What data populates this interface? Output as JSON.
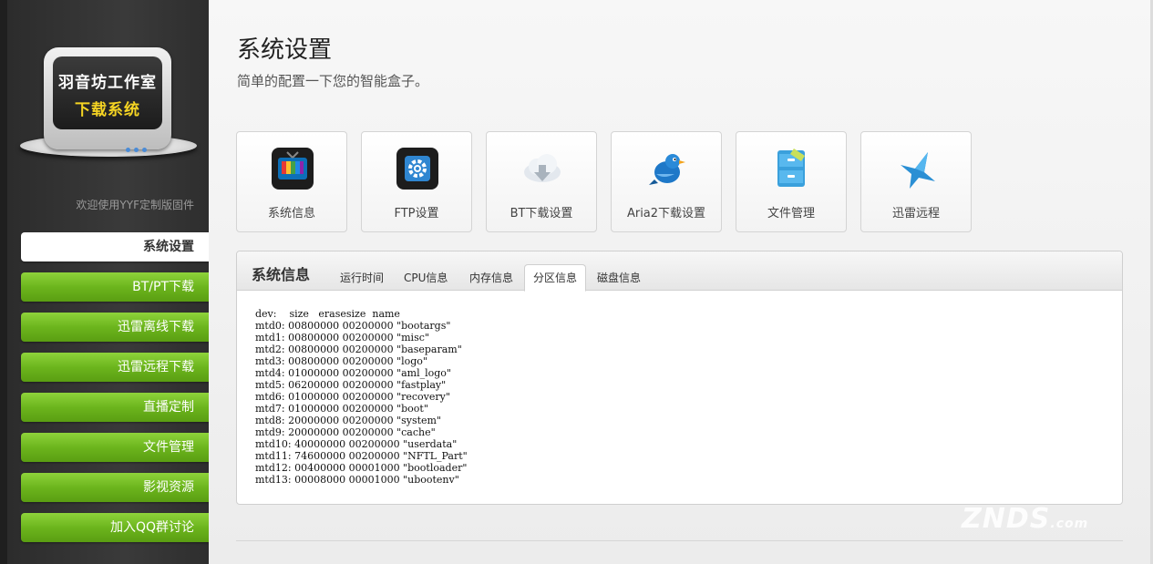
{
  "sidebar": {
    "logo": {
      "line1": "羽音坊工作室",
      "line2": "下载系统"
    },
    "welcome": "欢迎使用YYF定制版固件",
    "items": [
      {
        "label": "系统设置",
        "active": true
      },
      {
        "label": "BT/PT下载"
      },
      {
        "label": "迅雷离线下载"
      },
      {
        "label": "迅雷远程下载"
      },
      {
        "label": "直播定制"
      },
      {
        "label": "文件管理"
      },
      {
        "label": "影视资源"
      },
      {
        "label": "加入QQ群讨论"
      }
    ]
  },
  "header": {
    "title": "系统设置",
    "subtitle": "简单的配置一下您的智能盒子。"
  },
  "tiles": [
    {
      "label": "系统信息",
      "icon": "tv-icon"
    },
    {
      "label": "FTP设置",
      "icon": "gear-icon"
    },
    {
      "label": "BT下载设置",
      "icon": "cloud-download-icon"
    },
    {
      "label": "Aria2下载设置",
      "icon": "bird-icon"
    },
    {
      "label": "文件管理",
      "icon": "file-cabinet-icon"
    },
    {
      "label": "迅雷远程",
      "icon": "thunder-bird-icon"
    }
  ],
  "panel": {
    "title": "系统信息",
    "tabs": [
      {
        "label": "运行时间"
      },
      {
        "label": "CPU信息"
      },
      {
        "label": "内存信息"
      },
      {
        "label": "分区信息",
        "active": true
      },
      {
        "label": "磁盘信息"
      }
    ],
    "content": "dev:    size   erasesize  name\nmtd0: 00800000 00200000 \"bootargs\"\nmtd1: 00800000 00200000 \"misc\"\nmtd2: 00800000 00200000 \"baseparam\"\nmtd3: 00800000 00200000 \"logo\"\nmtd4: 01000000 00200000 \"aml_logo\"\nmtd5: 06200000 00200000 \"fastplay\"\nmtd6: 01000000 00200000 \"recovery\"\nmtd7: 01000000 00200000 \"boot\"\nmtd8: 20000000 00200000 \"system\"\nmtd9: 20000000 00200000 \"cache\"\nmtd10: 40000000 00200000 \"userdata\"\nmtd11: 74600000 00200000 \"NFTL_Part\"\nmtd12: 00400000 00001000 \"bootloader\"\nmtd13: 00008000 00001000 \"ubootenv\""
  },
  "watermark": {
    "text": "ZNDS",
    "suffix": ".com"
  },
  "colors": {
    "nav_green": "#6cb51d",
    "logo_yellow": "#f5d423",
    "sidebar_bg": "#333333"
  }
}
